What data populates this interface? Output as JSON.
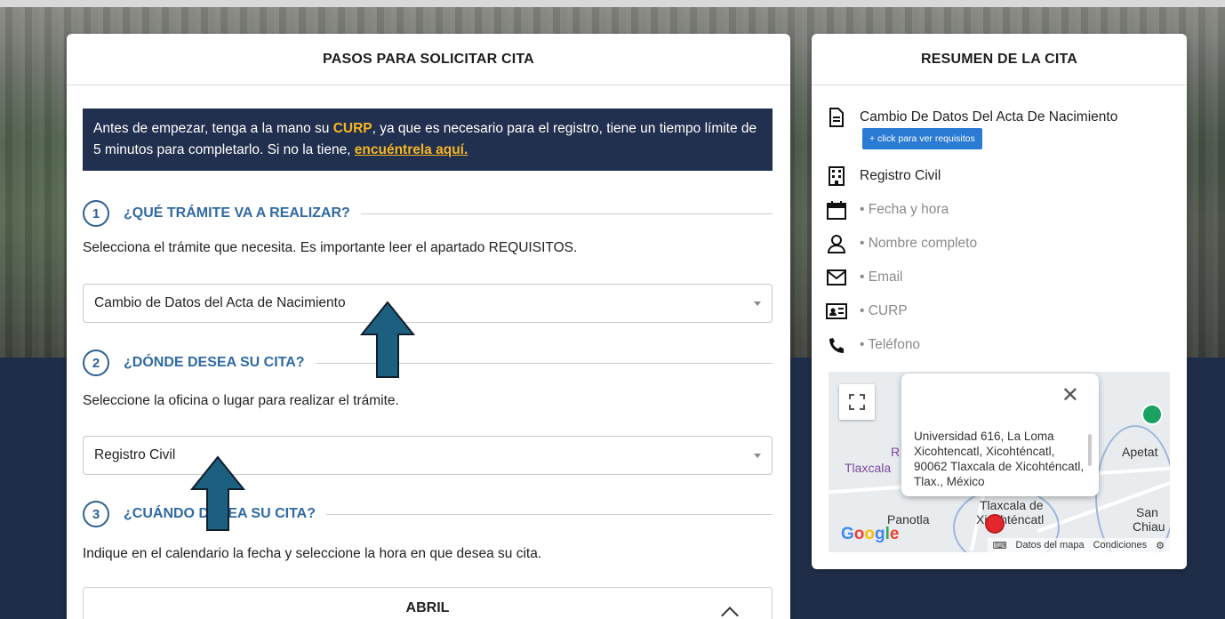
{
  "left_panel": {
    "title": "PASOS PARA SOLICITAR CITA",
    "notice": {
      "prefix": "Antes de empezar, tenga a la mano su ",
      "curp": "CURP",
      "middle": ", ya que es necesario para el registro, tiene un tiempo límite de 5 minutos para completarlo. Si no la tiene, ",
      "link": "encuéntrela aquí."
    },
    "steps": [
      {
        "number": "1",
        "title": "¿QUÉ TRÁMITE VA A REALIZAR?",
        "description": "Selecciona el trámite que necesita. Es importante leer el apartado REQUISITOS.",
        "select_value": "Cambio de Datos del Acta de Nacimiento"
      },
      {
        "number": "2",
        "title": "¿DÓNDE DESEA SU CITA?",
        "description": "Seleccione la oficina o lugar para realizar el trámite.",
        "select_value": "Registro Civil"
      },
      {
        "number": "3",
        "title": "¿CUÁNDO DESEA SU CITA?",
        "description": "Indique en el calendario la fecha y seleccione la hora en que desea su cita."
      }
    ],
    "calendar_month": "ABRIL"
  },
  "right_panel": {
    "title": "RESUMEN DE LA CITA",
    "procedure": "Cambio De Datos Del Acta De Nacimiento",
    "requirements_button": "+ click para ver requisitos",
    "office": "Registro Civil",
    "date_time": "• Fecha y hora",
    "full_name": "• Nombre completo",
    "email": "• Email",
    "curp": "• CURP",
    "phone": "• Teléfono",
    "map": {
      "popup_address": "Universidad 616, La Loma Xicohtencatl, Xicohténcatl, 90062 Tlaxcala de Xicohténcatl, Tlax., México",
      "labels": [
        "Tlaxcala",
        "R",
        "Apetat",
        "Panotla",
        "Tlaxcala de",
        "Xicohténcatl",
        "San",
        "Chiau"
      ],
      "footer_data": "Datos del mapa",
      "footer_terms": "Condiciones",
      "brand": "Google"
    }
  }
}
